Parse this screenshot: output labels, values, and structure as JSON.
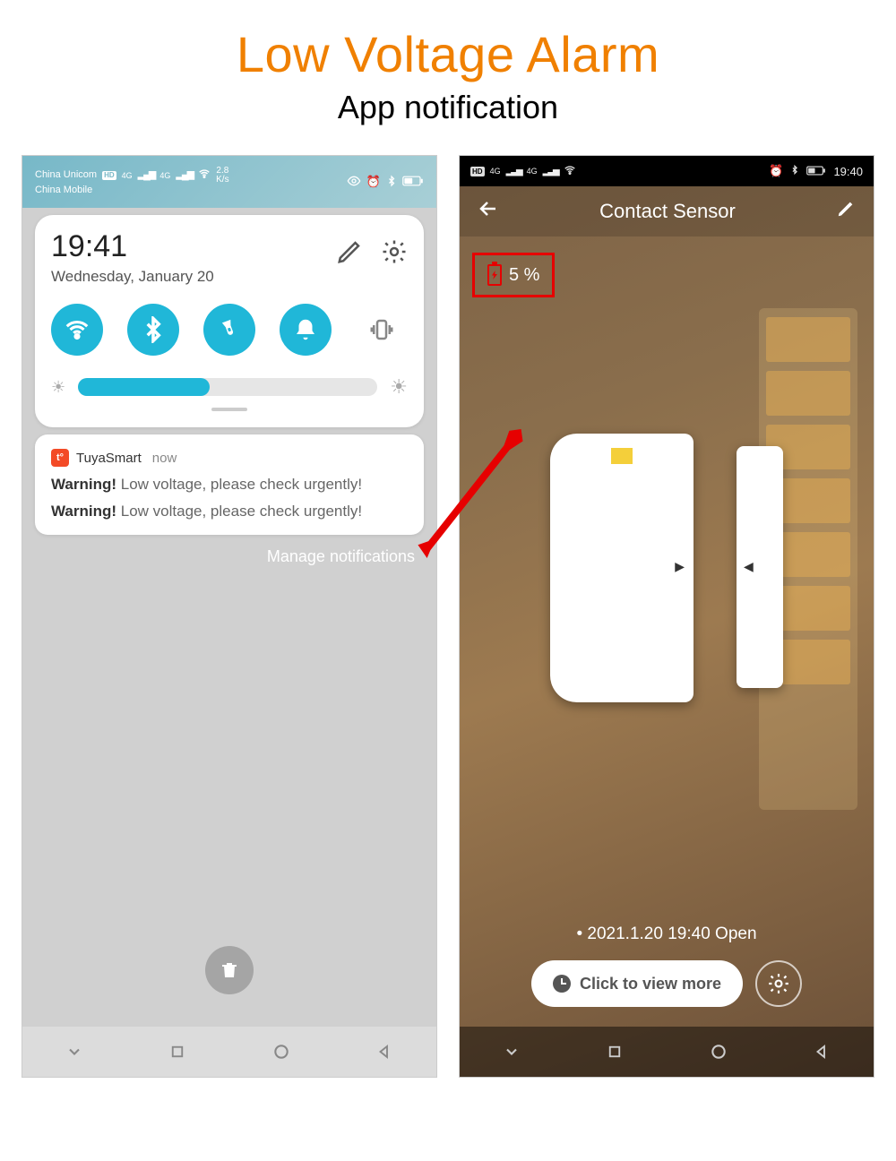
{
  "header": {
    "title": "Low Voltage Alarm",
    "subtitle": "App notification"
  },
  "left": {
    "status": {
      "carrier1": "China Unicom",
      "carrier2": "China Mobile",
      "hd_label": "HD",
      "net_label": "4G",
      "speed_up": "2.8",
      "speed_unit": "K/s"
    },
    "quick": {
      "time": "19:41",
      "date": "Wednesday, January 20"
    },
    "notif": {
      "app": "TuyaSmart",
      "time": "now",
      "line1_bold": "Warning!",
      "line1_rest": " Low voltage, please check urgently!",
      "line2_bold": "Warning!",
      "line2_rest": " Low voltage, please check urgently!"
    },
    "manage": "Manage notifications"
  },
  "right": {
    "status": {
      "hd": "HD",
      "net": "4G",
      "time": "19:40"
    },
    "title": "Contact Sensor",
    "battery_pct": "5 %",
    "event_text": "2021.1.20 19:40 Open",
    "view_more": "Click to view more"
  }
}
